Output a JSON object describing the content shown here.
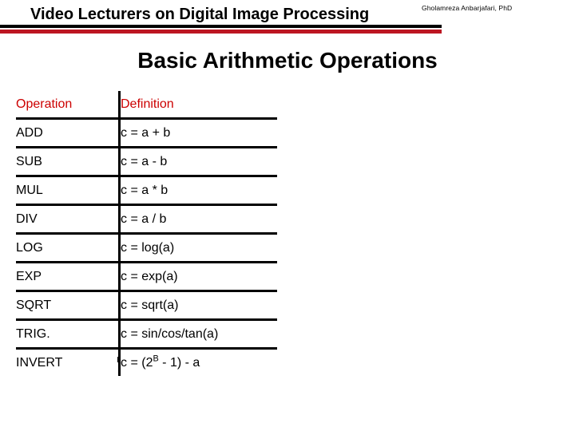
{
  "header": {
    "title": "Video Lecturers on Digital Image Processing",
    "author": "Gholamreza Anbarjafari, PhD",
    "rule_black_color": "#000000",
    "rule_red_color": "#bd1622"
  },
  "slide": {
    "title": "Basic Arithmetic Operations"
  },
  "table": {
    "header_color": "#cc0000",
    "columns": [
      {
        "key": "operation",
        "label": "Operation"
      },
      {
        "key": "definition",
        "label": "Definition"
      }
    ],
    "rows": [
      {
        "operation": "ADD",
        "definition": "c = a + b"
      },
      {
        "operation": "SUB",
        "definition": "c = a - b"
      },
      {
        "operation": "MUL",
        "definition": "c = a * b"
      },
      {
        "operation": "DIV",
        "definition": "c = a / b"
      },
      {
        "operation": "LOG",
        "definition": "c = log(a)"
      },
      {
        "operation": "EXP",
        "definition": "c = exp(a)"
      },
      {
        "operation": "SQRT",
        "definition": "c = sqrt(a)"
      },
      {
        "operation": "TRIG.",
        "definition": "c = sin/cos/tan(a)"
      },
      {
        "operation": "INVERT",
        "definition_parts": {
          "pre": "c = (2",
          "sup": "B",
          "post": " - 1) - a"
        }
      }
    ]
  }
}
